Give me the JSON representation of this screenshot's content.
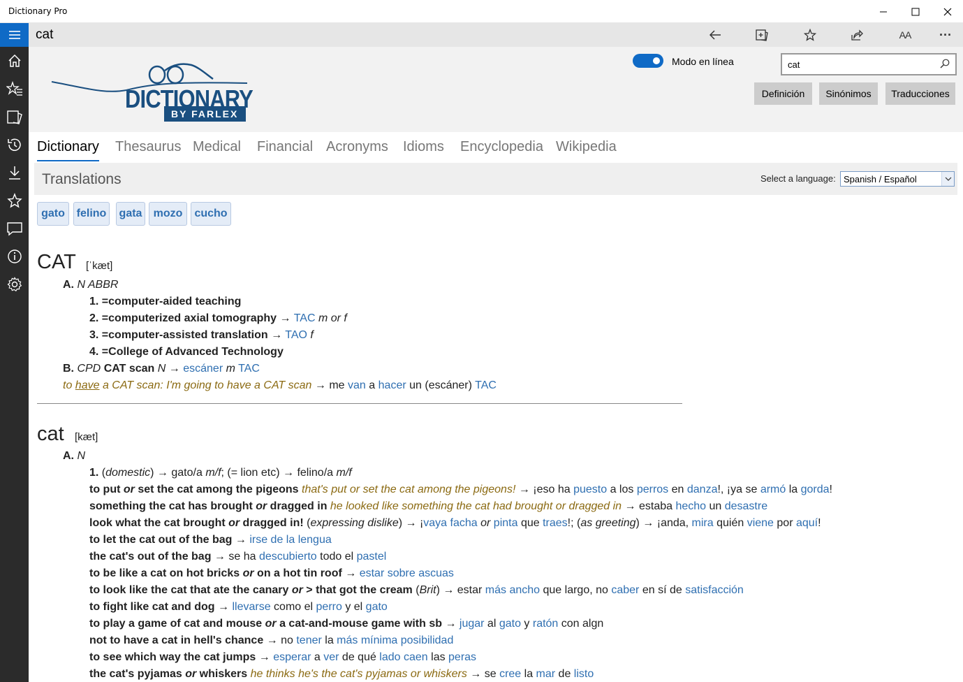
{
  "window": {
    "title": "Dictionary Pro",
    "min": "—",
    "max": "☐",
    "close": "✕"
  },
  "rail": {
    "icons": [
      "menu-icon",
      "home-icon",
      "favorites-list-icon",
      "flashcards-icon",
      "history-icon",
      "download-icon",
      "star-icon",
      "feedback-icon",
      "info-icon",
      "settings-icon"
    ]
  },
  "topbar": {
    "query": "cat",
    "icons": [
      "back-arrow-icon",
      "add-flashcard-icon",
      "favorite-star-icon",
      "share-icon",
      "font-size-icon",
      "more-icon"
    ],
    "font_size_label": "AA",
    "more_label": "···"
  },
  "header": {
    "logo_main": "DICTIONARY",
    "logo_sub": "BY FARLEX",
    "toggle_label": "Modo en línea",
    "search_value": "cat",
    "buttons": {
      "definition": "Definición",
      "synonyms": "Sinónimos",
      "translations": "Traducciones"
    }
  },
  "tabs": [
    "Dictionary",
    "Thesaurus",
    "Medical",
    "Financial",
    "Acronyms",
    "Idioms",
    "Encyclopedia",
    "Wikipedia"
  ],
  "translations": {
    "title": "Translations",
    "lang_label": "Select a language:",
    "lang_value": "Spanish / Español"
  },
  "chips": [
    "gato",
    "felino",
    "gata",
    "mozo",
    "cucho"
  ],
  "entry1": {
    "headword": "CAT",
    "phonetic": "[ˈkæt]",
    "a_letter": "A.",
    "a_pos": "N ABBR",
    "s1_num": "1.",
    "s1_text": "=computer-aided teaching",
    "s2_num": "2.",
    "s2_text": "=computerized axial tomography",
    "s2_arrow": "→",
    "s2_tr": "TAC",
    "s2_g": "m or f",
    "s3_num": "3.",
    "s3_text": "=computer-assisted translation",
    "s3_arrow": "→",
    "s3_tr": "TAO",
    "s3_g": "f",
    "s4_num": "4.",
    "s4_text": "=College of Advanced Technology",
    "b_letter": "B.",
    "b_cpd": "CPD",
    "b_term": "CAT scan",
    "b_pos": "N",
    "b_arrow": "→",
    "b_tr1": "escáner",
    "b_g": "m",
    "b_tr2": "TAC",
    "ex_pre": "to",
    "ex_have": "have",
    "ex_rest": "a CAT scan: I'm going to have a CAT scan",
    "ex_arrow": "→",
    "ex_me": "me",
    "ex_van": "van",
    "ex_a": "a",
    "ex_hacer": "hacer",
    "ex_un": "un (escáner)",
    "ex_tac": "TAC"
  },
  "entry2": {
    "headword": "cat",
    "phonetic": "[kæt]",
    "a_letter": "A.",
    "a_pos": "N",
    "lines": [
      {
        "b": "1.",
        "t": " (",
        "i": "domestic",
        "t2": ") → gato/a ",
        "i2": "m/f",
        "t3": "; (= lion etc) → felino/a ",
        "i3": "m/f"
      },
      {
        "b": "to put ",
        "bi": "or",
        "b2": " set the cat among the pigeons ",
        "ex": "that's put or set the cat among the pigeons!",
        "t": " → ¡eso ha ",
        "l1": "puesto",
        "t2": " a los ",
        "l2": "perros",
        "t3": " en ",
        "l3": "danza",
        "t4": "!, ¡ya se ",
        "l4": "armó",
        "t5": " la ",
        "l5": "gorda",
        "t6": "!"
      },
      {
        "b": "something the cat has brought ",
        "bi": "or",
        "b2": " dragged in ",
        "ex": "he looked like something the cat had brought or dragged in",
        "t": " → estaba ",
        "l1": "hecho",
        "t2": " un ",
        "l2": "desastre"
      },
      {
        "b": "look what the cat brought ",
        "bi": "or",
        "b2": " dragged in!",
        "t": " (",
        "i": "expressing dislike",
        "t2": ") → ¡",
        "l1": "vaya facha",
        "i2": " or ",
        "l2": "pinta",
        "t3": " que ",
        "l3": "traes",
        "t4": "!; (",
        "i3": "as greeting",
        "t5": ") → ¡anda, ",
        "l4": "mira",
        "t6": " quién ",
        "l5": "viene",
        "t7": " por ",
        "l6": "aquí",
        "t8": "!"
      },
      {
        "b": "to let the cat out of the bag",
        "t": " → ",
        "l1": "irse de la lengua"
      },
      {
        "b": "the cat's out of the bag",
        "t": " → se ha ",
        "l1": "descubierto",
        "t2": " todo el ",
        "l2": "pastel"
      },
      {
        "b": "to be like a cat on hot bricks ",
        "bi": "or",
        "b2": " on a hot tin roof",
        "t": " → ",
        "l1": "estar sobre ascuas"
      },
      {
        "b": "to look like the cat that ate the canary ",
        "bi": "or",
        "b2": " > that got the cream",
        "t": " (",
        "i": "Brit",
        "t2": ") → estar ",
        "l1": "más ancho",
        "t3": " que largo, no ",
        "l2": "caber",
        "t4": " en sí de ",
        "l3": "satisfacción"
      },
      {
        "b": "to fight like cat and dog",
        "t": " → ",
        "l1": "llevarse",
        "t2": " como el ",
        "l2": "perro",
        "t3": " y el ",
        "l3": "gato"
      },
      {
        "b": "to play a game of cat and mouse ",
        "bi": "or",
        "b2": " a cat-and-mouse game with sb",
        "t": " → ",
        "l1": "jugar",
        "t2": " al ",
        "l2": "gato",
        "t3": " y ",
        "l3": "ratón",
        "t4": " con algn"
      },
      {
        "b": "not to have a cat in hell's chance",
        "t": " → no ",
        "l1": "tener",
        "t2": " la ",
        "l2": "más mínima posibilidad"
      },
      {
        "b": "to see which way the cat jumps",
        "t": " → ",
        "l1": "esperar",
        "t2": " a ",
        "l2": "ver",
        "t3": " de qué ",
        "l3": "lado caen",
        "t4": " las ",
        "l4": "peras"
      },
      {
        "b": "the cat's pyjamas ",
        "bi": "or",
        "b2": " whiskers ",
        "ex": "he thinks he's the cat's pyjamas or whiskers",
        "t": " → se ",
        "l1": "cree",
        "t2": " la ",
        "l2": "mar",
        "t3": " de ",
        "l3": "listo"
      }
    ]
  }
}
